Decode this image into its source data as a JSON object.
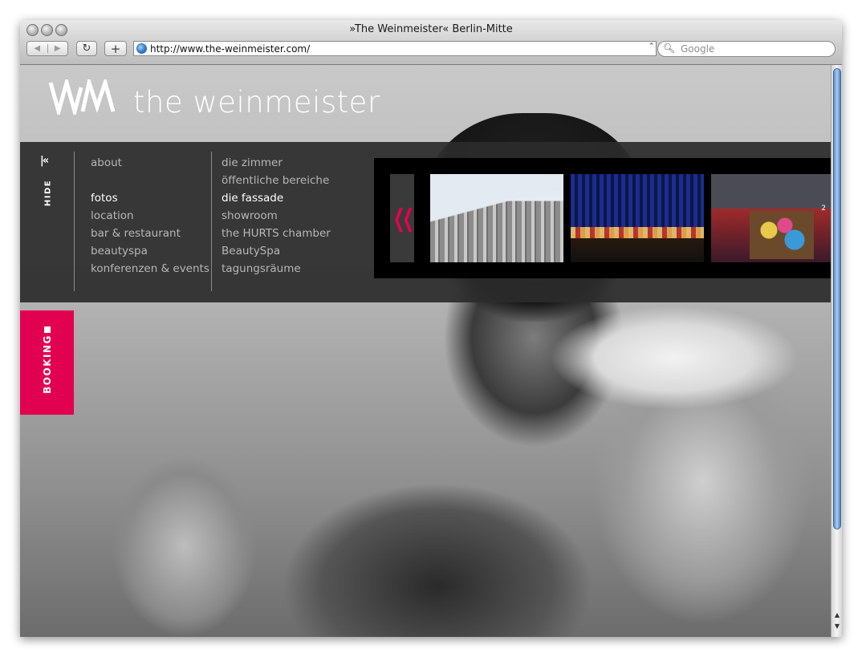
{
  "window": {
    "title": "»The Weinmeister« Berlin-Mitte"
  },
  "toolbar": {
    "back_icon": "back-arrow-icon",
    "forward_icon": "forward-arrow-icon",
    "reload_glyph": "↻",
    "add_glyph": "+",
    "url": "http://www.the-weinmeister.com/",
    "search_placeholder": "Google"
  },
  "site": {
    "logo_text": "the weinmeister",
    "hide_label": "HIDE",
    "booking_label": "BOOKING",
    "accent_color": "#e20050"
  },
  "menu": {
    "col1": [
      {
        "label": "about",
        "active": false
      },
      {
        "label": "",
        "active": false
      },
      {
        "label": "fotos",
        "active": true
      },
      {
        "label": "location",
        "active": false
      },
      {
        "label": "bar & restaurant",
        "active": false
      },
      {
        "label": "beautyspa",
        "active": false
      },
      {
        "label": "konferenzen & events",
        "active": false
      }
    ],
    "col2": [
      {
        "label": "die zimmer",
        "active": false
      },
      {
        "label": "öffentliche bereiche",
        "active": false
      },
      {
        "label": "die fassade",
        "active": true
      },
      {
        "label": "showroom",
        "active": false
      },
      {
        "label": "the HURTS chamber",
        "active": false
      },
      {
        "label": "BeautySpa",
        "active": false
      },
      {
        "label": "tagungsräume",
        "active": false
      }
    ]
  },
  "gallery": {
    "prev_glyph": "❮❮",
    "thumb_badge": "2"
  }
}
